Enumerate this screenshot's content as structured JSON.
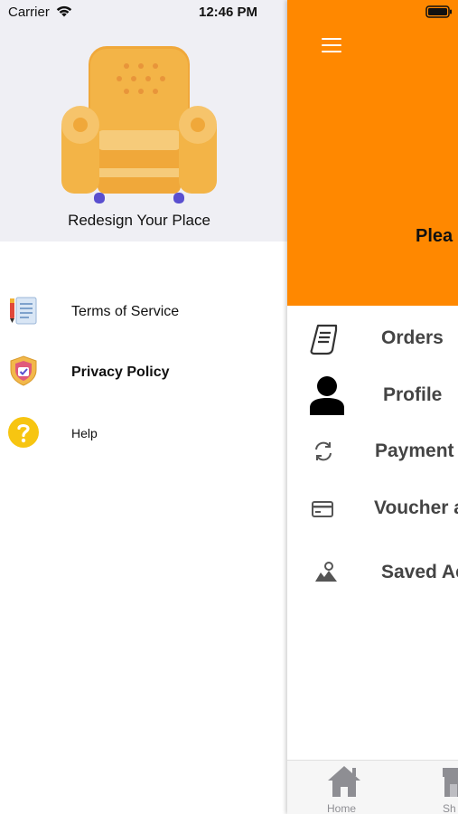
{
  "status_bar": {
    "carrier": "Carrier",
    "time": "12:46 PM"
  },
  "drawer": {
    "brand_text": "Redesign Your Place",
    "items": [
      {
        "label": "Terms of Service",
        "icon": "document-pen-icon"
      },
      {
        "label": "Privacy Policy",
        "icon": "shield-check-icon"
      },
      {
        "label": "Help",
        "icon": "question-icon"
      }
    ]
  },
  "main": {
    "header_color": "#ff8800",
    "greeting": "Plea",
    "menu": [
      {
        "label": "Orders",
        "icon": "receipt-icon"
      },
      {
        "label": "Profile",
        "icon": "person-icon"
      },
      {
        "label": "Payment",
        "icon": "refresh-icon"
      },
      {
        "label": "Voucher a",
        "icon": "card-icon"
      },
      {
        "label": "Saved Ac",
        "icon": "map-pin-icon"
      }
    ],
    "tabs": [
      {
        "label": "Home",
        "icon": "home-icon"
      },
      {
        "label": "Sh",
        "icon": "shop-icon"
      }
    ]
  }
}
